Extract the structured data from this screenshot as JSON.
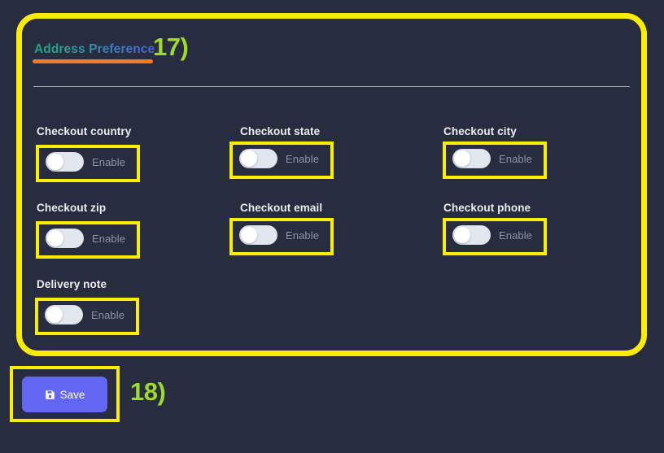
{
  "theme": {
    "background": "#282c3f",
    "annotation_color": "#fbec05",
    "annotation_number_color": "#9fd92b",
    "title_underline_color": "#f47b28",
    "save_button_color": "#6366f1",
    "divider_color": "#c9cdd8",
    "label_color": "#eceef5",
    "switch_text_color": "#8c93a6",
    "switch_track_color": "#e2e6ee",
    "switch_knob_color": "#ffffff"
  },
  "card": {
    "title": "Address Preference",
    "annotation": "17)",
    "fields": [
      {
        "label": "Checkout country",
        "switch_label": "Enable",
        "state": "off"
      },
      {
        "label": "Checkout state",
        "switch_label": "Enable",
        "state": "off"
      },
      {
        "label": "Checkout city",
        "switch_label": "Enable",
        "state": "off"
      },
      {
        "label": "Checkout zip",
        "switch_label": "Enable",
        "state": "off"
      },
      {
        "label": "Checkout email",
        "switch_label": "Enable",
        "state": "off"
      },
      {
        "label": "Checkout phone",
        "switch_label": "Enable",
        "state": "off"
      },
      {
        "label": "Delivery note",
        "switch_label": "Enable",
        "state": "off"
      }
    ]
  },
  "footer": {
    "save_label": "Save",
    "save_icon": "floppy-disk-icon",
    "annotation": "18)"
  }
}
